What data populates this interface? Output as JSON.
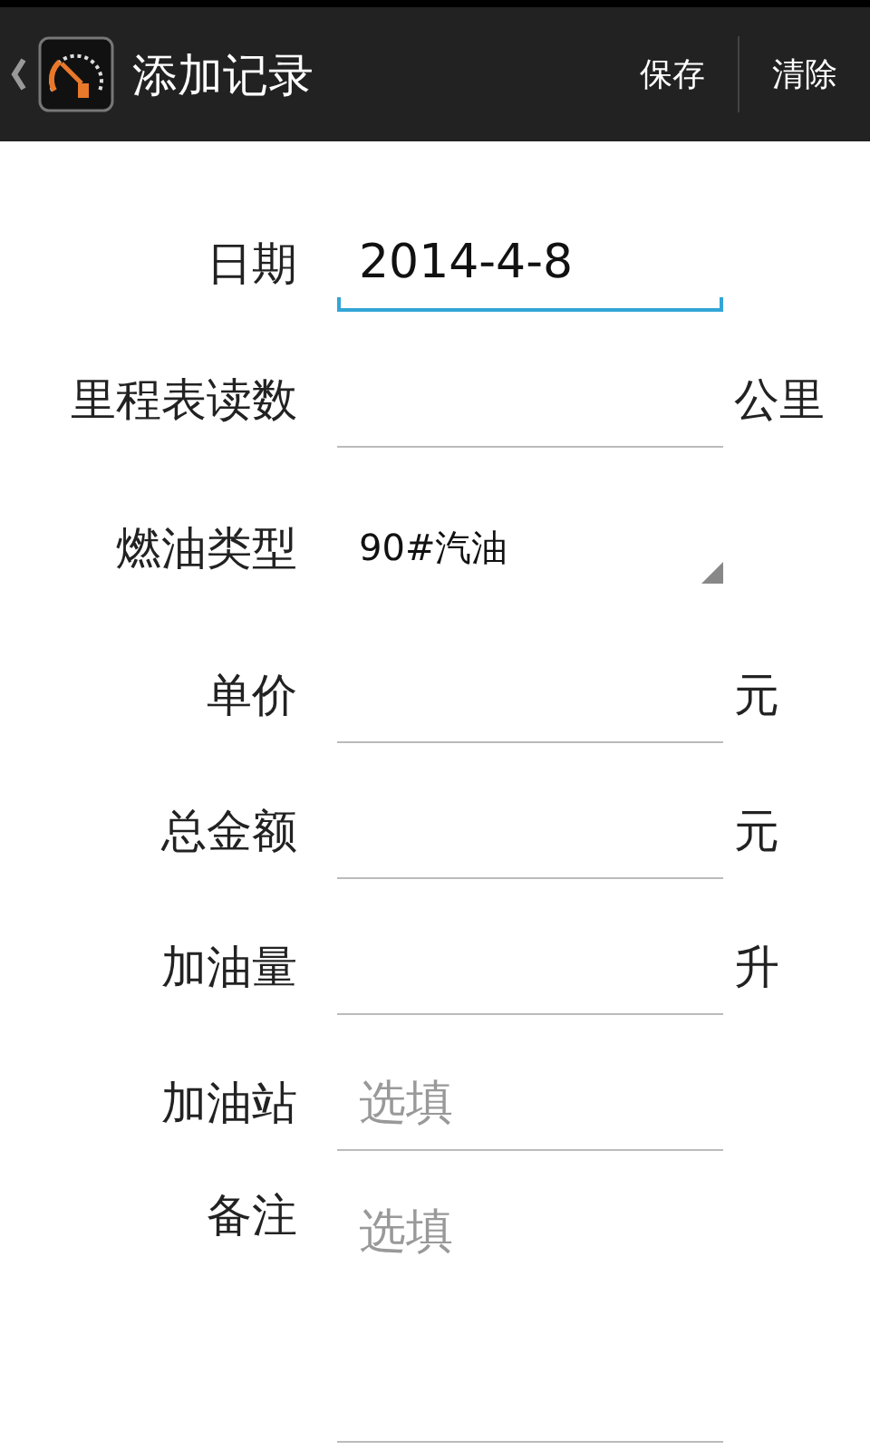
{
  "action_bar": {
    "title": "添加记录",
    "actions": [
      "保存",
      "清除"
    ]
  },
  "form": [
    {
      "kind": "text",
      "label": "日期",
      "value": "2014-4-8",
      "focused": true
    },
    {
      "kind": "text",
      "label": "里程表读数",
      "unit": "公里",
      "focused": false
    },
    {
      "kind": "select",
      "label": "燃油类型",
      "value": "90#汽油"
    },
    {
      "kind": "text",
      "label": "单价",
      "unit": "元",
      "focused": false
    },
    {
      "kind": "text",
      "label": "总金额",
      "unit": "元",
      "focused": false
    },
    {
      "kind": "text",
      "label": "加油量",
      "unit": "升",
      "focused": false
    },
    {
      "kind": "text",
      "label": "加油站",
      "placeholder": "选填",
      "focused": false
    },
    {
      "kind": "multiline",
      "label": "备注",
      "placeholder": "选填",
      "focused": false
    }
  ]
}
